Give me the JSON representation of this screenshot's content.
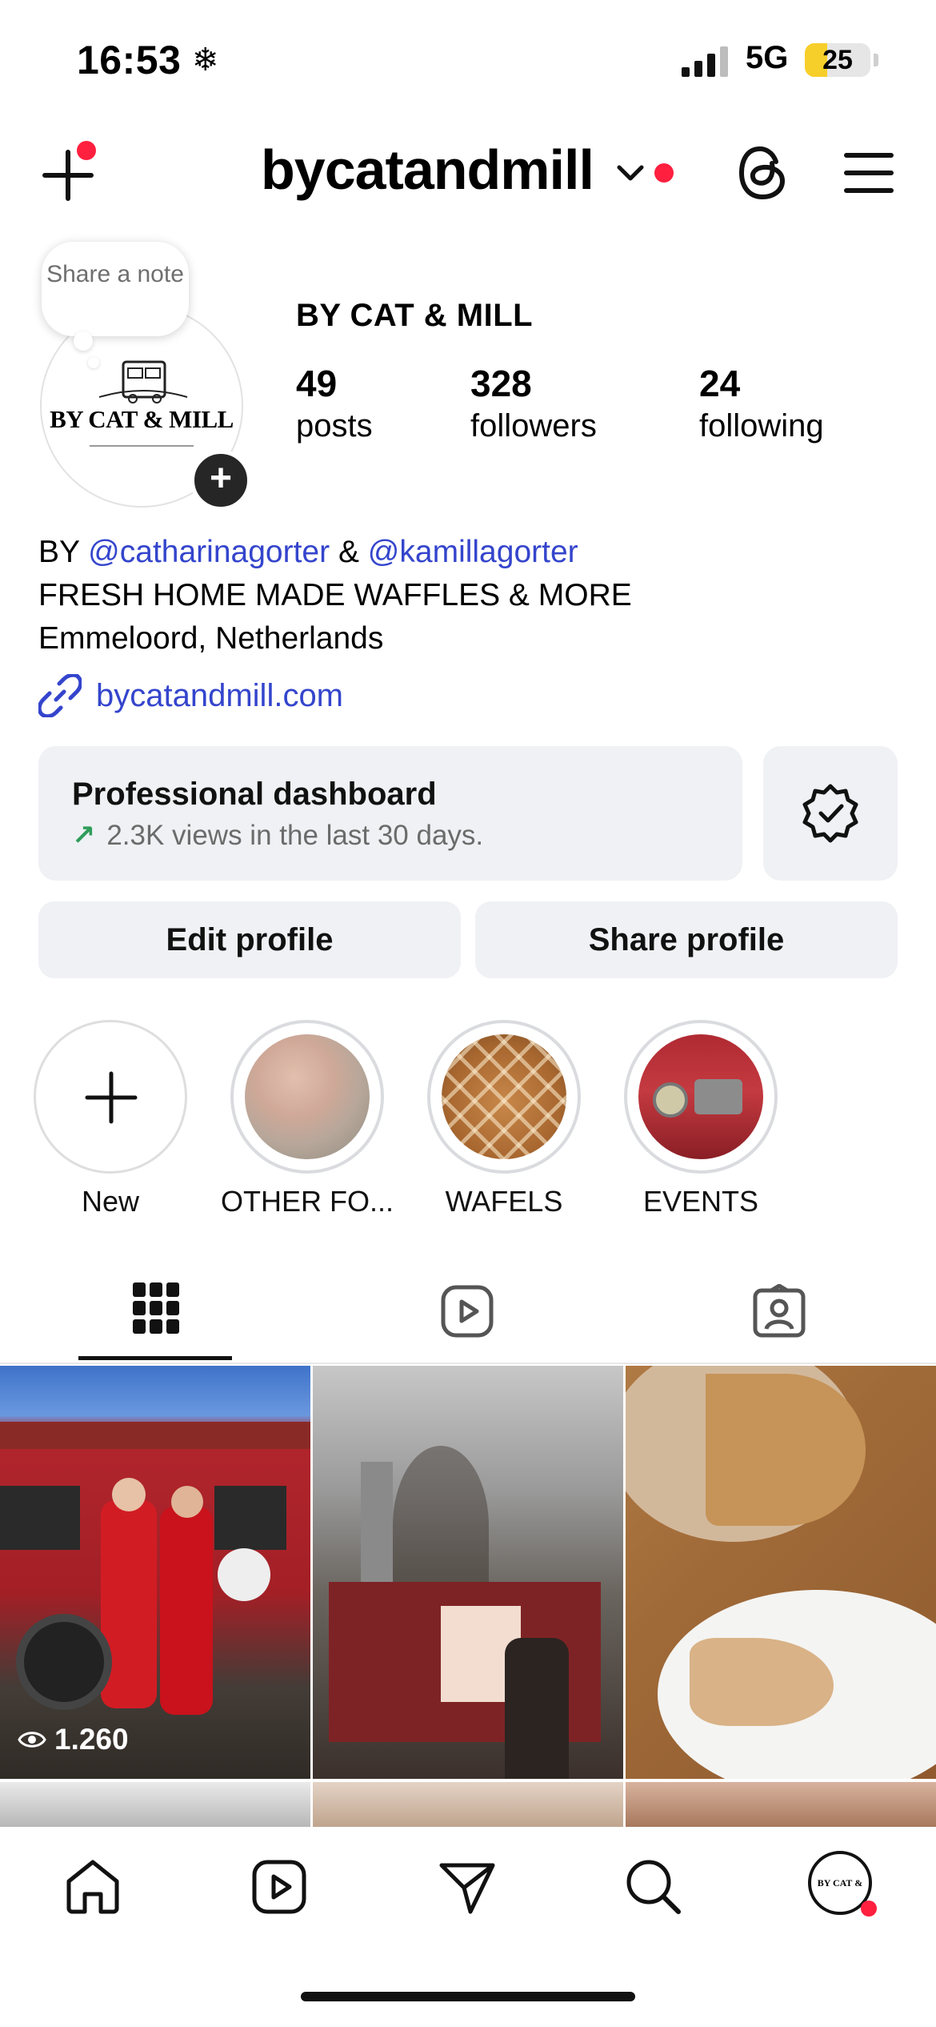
{
  "status_bar": {
    "time": "16:53",
    "weather_glyph": "❄",
    "network": "5G",
    "battery": "25"
  },
  "header": {
    "username": "bycatandmill",
    "icons": [
      "plus-icon",
      "chevron-down-icon",
      "threads-icon",
      "menu-icon"
    ]
  },
  "profile": {
    "note_text": "Share a note",
    "logo_text": "BY CAT & MILL",
    "full_name": "BY CAT & MILL",
    "stats": [
      {
        "value": "49",
        "label": "posts"
      },
      {
        "value": "328",
        "label": "followers"
      },
      {
        "value": "24",
        "label": "following"
      }
    ]
  },
  "bio": {
    "by": "BY",
    "mention1": "@catharinagorter",
    "amp": "&",
    "mention2": "@kamillagorter",
    "line2": "FRESH HOME MADE WAFFLES & MORE",
    "line3": "Emmeloord, Netherlands",
    "link": "bycatandmill.com"
  },
  "dashboard": {
    "title": "Professional dashboard",
    "arrow": "↗",
    "subtitle": "2.3K views in the last 30 days."
  },
  "actions": {
    "edit": "Edit profile",
    "share": "Share profile"
  },
  "highlights": [
    {
      "label": "New"
    },
    {
      "label": "OTHER FO..."
    },
    {
      "label": "WAFELS"
    },
    {
      "label": "EVENTS"
    }
  ],
  "tabs": [
    "grid-icon",
    "reels-icon",
    "tagged-icon"
  ],
  "grid": {
    "first_post_views": "1.260"
  },
  "bottom_nav": [
    "home-icon",
    "reels-icon",
    "send-icon",
    "search-icon",
    "profile-avatar"
  ],
  "colors": {
    "accent_link": "#3445cc",
    "notification": "#ff1f3f",
    "button_bg": "#eff1f4"
  }
}
